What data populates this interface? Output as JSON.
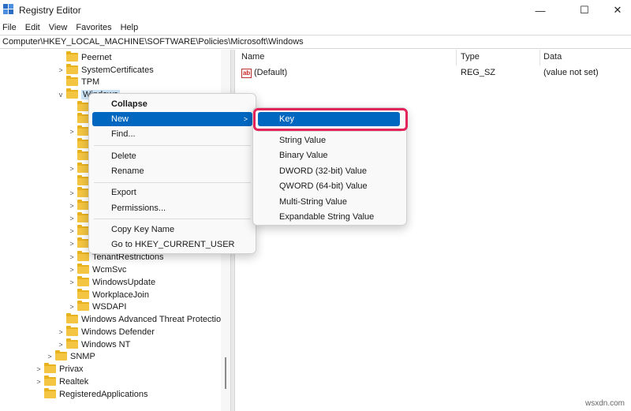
{
  "window": {
    "title": "Registry Editor",
    "controls": {
      "minimize": "—",
      "maximize": "☐",
      "close": "✕"
    }
  },
  "menubar": [
    "File",
    "Edit",
    "View",
    "Favorites",
    "Help"
  ],
  "address": "Computer\\HKEY_LOCAL_MACHINE\\SOFTWARE\\Policies\\Microsoft\\Windows",
  "tree": [
    {
      "label": "Peernet",
      "expander": ""
    },
    {
      "label": "SystemCertificates",
      "expander": ">"
    },
    {
      "label": "TPM",
      "expander": ""
    },
    {
      "label": "Windows",
      "expander": "v"
    },
    {
      "label": "TenantRestrictions",
      "expander": ">"
    },
    {
      "label": "WcmSvc",
      "expander": ">"
    },
    {
      "label": "WindowsUpdate",
      "expander": ">"
    },
    {
      "label": "WorkplaceJoin",
      "expander": ""
    },
    {
      "label": "WSDAPI",
      "expander": ">"
    },
    {
      "label": "Windows Advanced Threat Protection",
      "expander": ""
    },
    {
      "label": "Windows Defender",
      "expander": ">"
    },
    {
      "label": "Windows NT",
      "expander": ">"
    },
    {
      "label": "SNMP",
      "expander": ">"
    },
    {
      "label": "Privax",
      "expander": ">"
    },
    {
      "label": "Realtek",
      "expander": ">"
    },
    {
      "label": "RegisteredApplications",
      "expander": ""
    }
  ],
  "values_pane": {
    "columns": [
      "Name",
      "Type",
      "Data"
    ],
    "rows": [
      {
        "icon": "ab",
        "name": "(Default)",
        "type": "REG_SZ",
        "data": "(value not set)"
      }
    ]
  },
  "context_menu": {
    "items": [
      "Collapse",
      "New",
      "Find...",
      "Delete",
      "Rename",
      "Export",
      "Permissions...",
      "Copy Key Name",
      "Go to HKEY_CURRENT_USER"
    ]
  },
  "submenu": {
    "items": [
      "Key",
      "String Value",
      "Binary Value",
      "DWORD (32-bit) Value",
      "QWORD (64-bit) Value",
      "Multi-String Value",
      "Expandable String Value"
    ]
  },
  "colors": {
    "highlight": "#0067c0",
    "callout": "#e3245a",
    "folder": "#f4c542"
  },
  "watermark": "wsxdn.com"
}
